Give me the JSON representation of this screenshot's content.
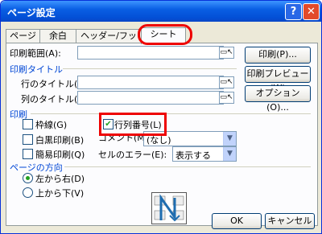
{
  "window": {
    "title": "ページ設定"
  },
  "titlebar": {
    "help": "?",
    "close": "✕"
  },
  "tabs": [
    "ページ",
    "余白",
    "ヘッダー/フッター",
    "シート"
  ],
  "print_area": {
    "label": "印刷範囲(A):",
    "value": ""
  },
  "print_titles": {
    "section": "印刷タイトル",
    "rows_label": "行のタイトル(R):",
    "rows_value": "",
    "cols_label": "列のタイトル(C):",
    "cols_value": ""
  },
  "print": {
    "section": "印刷",
    "gridlines": {
      "label": "枠線(G)",
      "checked": false
    },
    "row_col_headings": {
      "label": "行列番号(L)",
      "checked": true
    },
    "black_white": {
      "label": "白黒印刷(B)",
      "checked": false
    },
    "draft": {
      "label": "簡易印刷(Q)",
      "checked": false
    },
    "comments_label": "コメント(M):",
    "comments_value": "(なし)",
    "cell_errors_label": "セルのエラー(E):",
    "cell_errors_value": "表示する"
  },
  "page_order": {
    "section": "ページの方向",
    "left_to_right": "左から右(D)",
    "top_to_bottom": "上から下(V)",
    "selected": "left_to_right"
  },
  "buttons": {
    "print": "印刷(P)...",
    "preview": "印刷プレビュー(W)",
    "options": "オプション(O)...",
    "ok": "OK",
    "cancel": "キャンセル"
  }
}
